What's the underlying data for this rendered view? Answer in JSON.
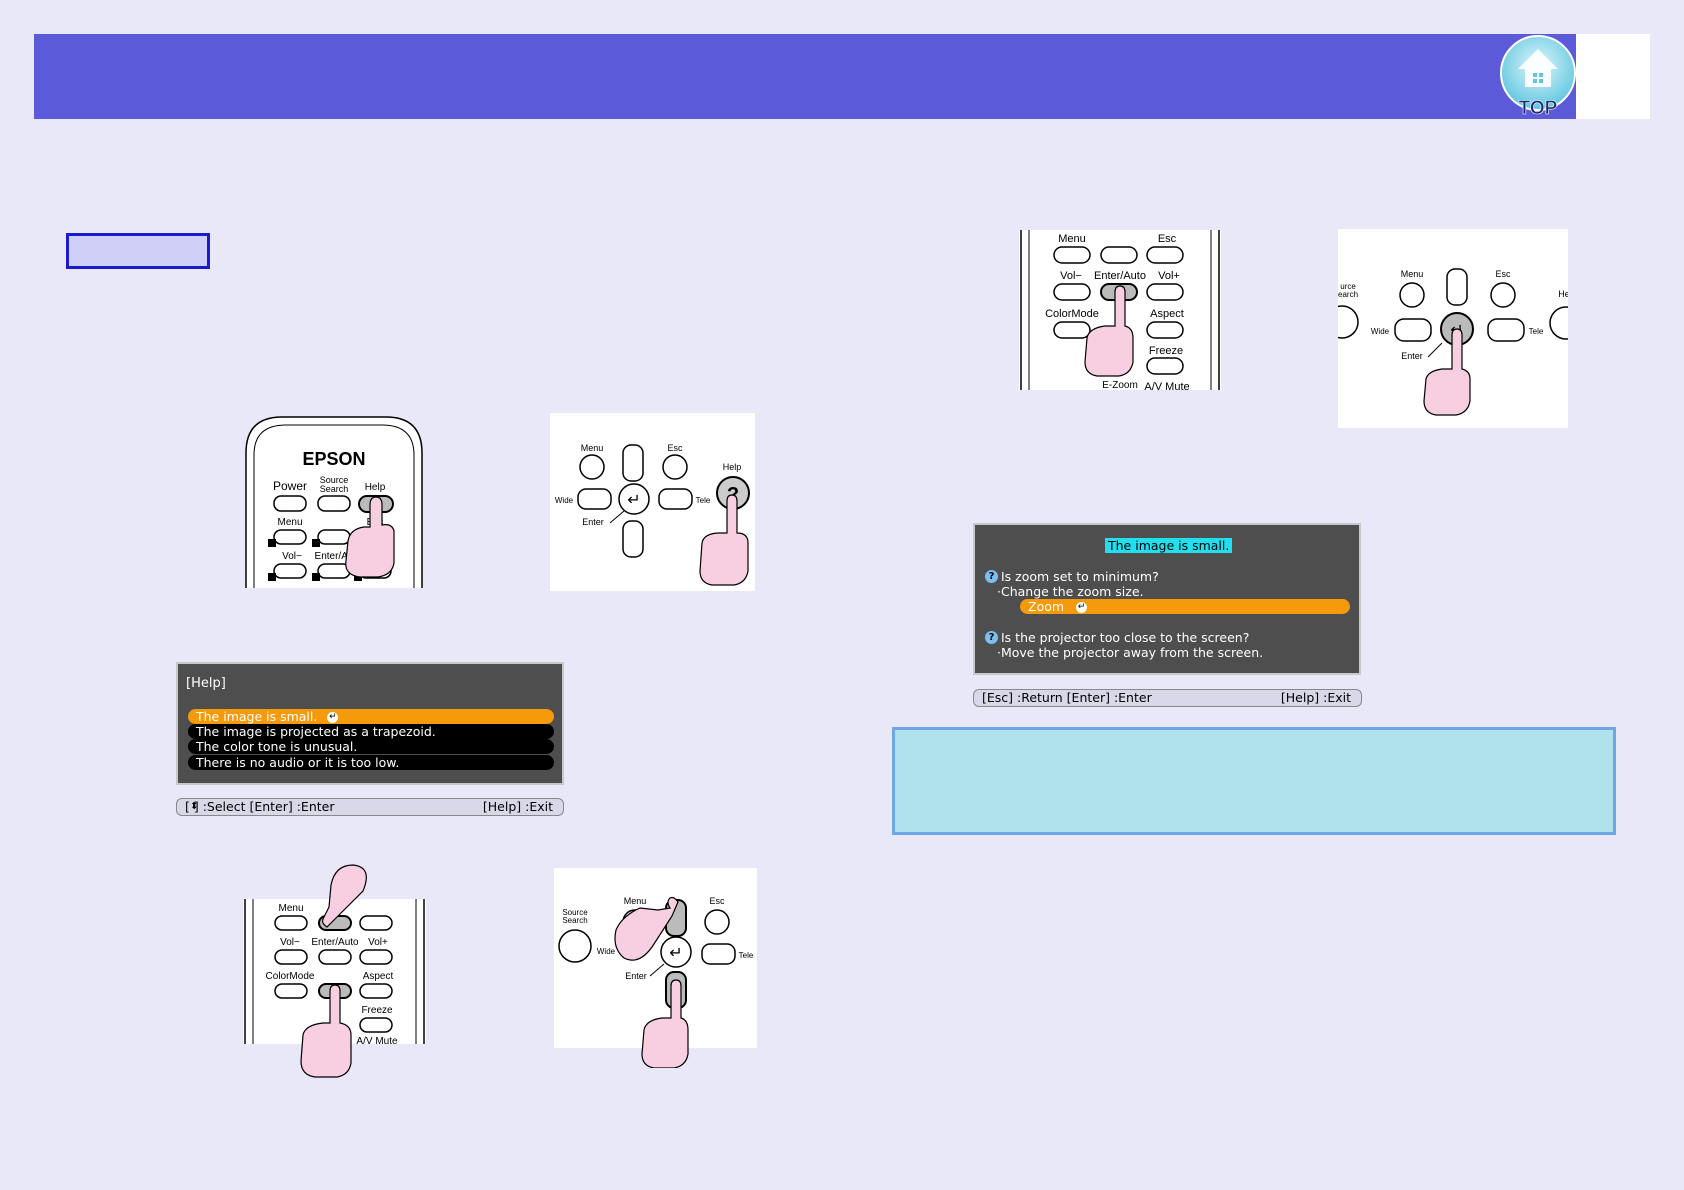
{
  "header": {
    "top_button_label": "TOP"
  },
  "remote_labels": {
    "brand": "EPSON",
    "power": "Power",
    "source_search": [
      "Source",
      "Search"
    ],
    "help": "Help",
    "menu": "Menu",
    "esc": "Esc",
    "vol_minus": "Vol−",
    "vol_plus": "Vol+",
    "enter_auto": "Enter/Auto",
    "enter_auto_partial": "Enter/Au",
    "color_mode": "ColorMode",
    "aspect": "Aspect",
    "freeze": "Freeze",
    "e_zoom": "E-Zoom",
    "av_mute": "A/V Mute",
    "esc_partial": "Esc"
  },
  "panel_labels": {
    "menu": "Menu",
    "esc": "Esc",
    "help": "Help",
    "wide": "Wide",
    "tele": "Tele",
    "enter": "Enter",
    "source_search": [
      "Source",
      "Search"
    ],
    "source_search_cut": [
      "urce",
      "earch"
    ],
    "help_cut": "He"
  },
  "help_screen": {
    "title": "[Help]",
    "items": [
      "The image is small.",
      "The image is projected as a trapezoid.",
      "The color tone is unusual.",
      "There is no audio or it is too low."
    ],
    "status_left": "[ ] :Select  [Enter] :Enter",
    "status_right": "[Help] :Exit"
  },
  "help_detail_screen": {
    "title": "The image is small.",
    "q1": "Is zoom set to minimum?",
    "a1": "·Change the zoom size.",
    "zoom_button": "Zoom",
    "q2": "Is the projector too close to the screen?",
    "a2": "·Move the projector away from the screen.",
    "status_left": "[Esc] :Return  [Enter] :Enter",
    "status_right": "[Help] :Exit"
  },
  "colors": {
    "header": "#5b5bd9",
    "background": "#e8e8f8",
    "highlight": "#f59a0a",
    "note_box": "#b0e2ee",
    "title_cyan": "#20e0f0"
  }
}
